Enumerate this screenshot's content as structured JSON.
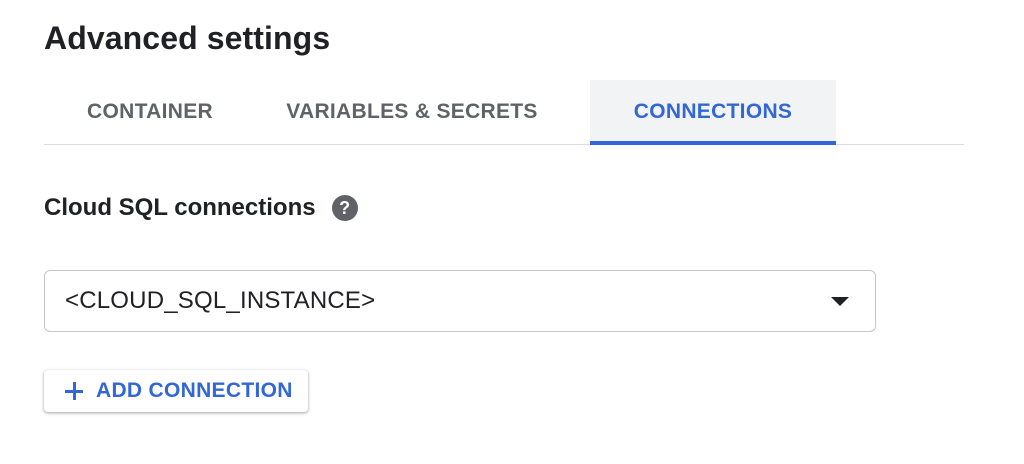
{
  "header": {
    "title": "Advanced settings"
  },
  "tabs": [
    {
      "label": "CONTAINER",
      "active": false
    },
    {
      "label": "VARIABLES & SECRETS",
      "active": false
    },
    {
      "label": "CONNECTIONS",
      "active": true
    }
  ],
  "cloud_sql": {
    "label": "Cloud SQL connections",
    "help_icon": "help-circle-icon",
    "help_glyph": "?",
    "selected_value": "<CLOUD_SQL_INSTANCE>",
    "dropdown_icon": "caret-down-icon",
    "add_button_label": "ADD CONNECTION",
    "add_button_icon": "plus-icon"
  },
  "colors": {
    "accent": "#3367d6",
    "text_primary": "#202124",
    "text_secondary": "#5f6368",
    "active_tab_bg": "#f1f3f4",
    "divider": "#dadce0"
  }
}
